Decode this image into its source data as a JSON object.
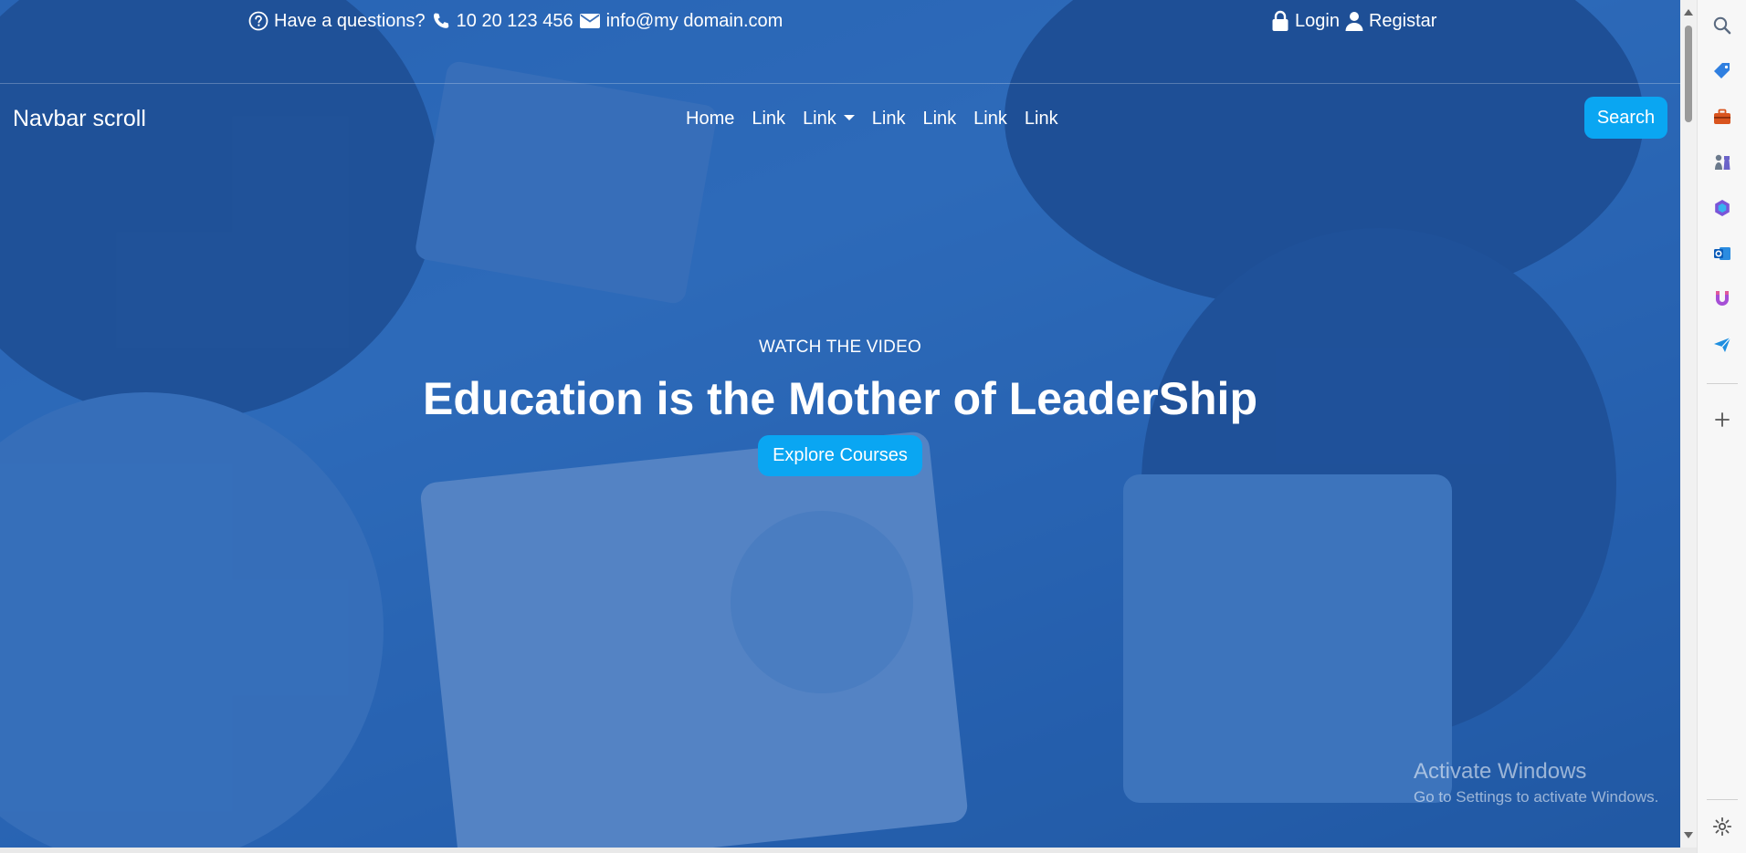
{
  "topbar": {
    "question_text": "Have a questions?",
    "phone": "10 20 123 456",
    "email": "info@my domain.com",
    "login_label": "Login",
    "register_label": "Registar"
  },
  "navbar": {
    "brand": "Navbar scroll",
    "links": [
      "Home",
      "Link",
      "Link",
      "Link",
      "Link",
      "Link",
      "Link"
    ],
    "search_label": "Search"
  },
  "hero": {
    "eyebrow": "WATCH THE VIDEO",
    "headline": "Education is the Mother of LeaderShip",
    "cta_label": "Explore Courses"
  },
  "watermark": {
    "title": "Activate Windows",
    "subtitle": "Go to Settings to activate Windows."
  },
  "sidebar_icons": [
    "search-icon",
    "tag-icon",
    "toolbox-icon",
    "chess-icon",
    "copilot-icon",
    "outlook-icon",
    "magnet-icon",
    "send-icon",
    "add-icon",
    "settings-icon"
  ],
  "colors": {
    "overlay": "#1654a8",
    "button": "#0aa6f2",
    "text": "#ffffff"
  }
}
